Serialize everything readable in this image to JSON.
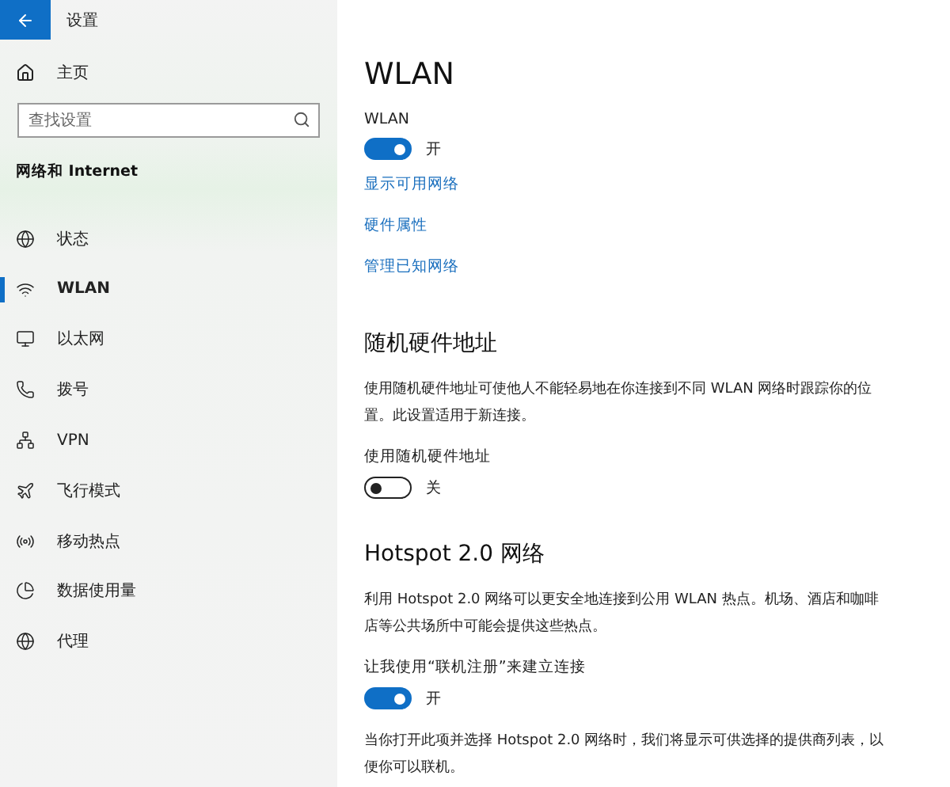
{
  "window": {
    "title": "设置"
  },
  "sidebar": {
    "home": "主页",
    "search": {
      "placeholder": "查找设置"
    },
    "section": "网络和 Internet",
    "items": [
      {
        "label": "状态",
        "selected": false
      },
      {
        "label": "WLAN",
        "selected": true
      },
      {
        "label": "以太网",
        "selected": false
      },
      {
        "label": "拨号",
        "selected": false
      },
      {
        "label": "VPN",
        "selected": false
      },
      {
        "label": "飞行模式",
        "selected": false
      },
      {
        "label": "移动热点",
        "selected": false
      },
      {
        "label": "数据使用量",
        "selected": false
      },
      {
        "label": "代理",
        "selected": false
      }
    ]
  },
  "main": {
    "title": "WLAN",
    "wlan_toggle": {
      "label": "WLAN",
      "on": true,
      "state": "开"
    },
    "links": [
      "显示可用网络",
      "硬件属性",
      "管理已知网络"
    ],
    "sections": [
      {
        "heading": "随机硬件地址",
        "description": "使用随机硬件地址可使他人不能轻易地在你连接到不同 WLAN 网络时跟踪你的位置。此设置适用于新连接。",
        "toggle": {
          "label": "使用随机硬件地址",
          "on": false,
          "state": "关"
        }
      },
      {
        "heading": "Hotspot 2.0 网络",
        "description": "利用 Hotspot 2.0 网络可以更安全地连接到公用 WLAN 热点。机场、酒店和咖啡店等公共场所中可能会提供这些热点。",
        "toggle": {
          "label": "让我使用“联机注册”来建立连接",
          "on": true,
          "state": "开"
        },
        "note": "当你打开此项并选择 Hotspot 2.0 网络时，我们将显示可供选择的提供商列表，以便你可以联机。"
      }
    ]
  }
}
